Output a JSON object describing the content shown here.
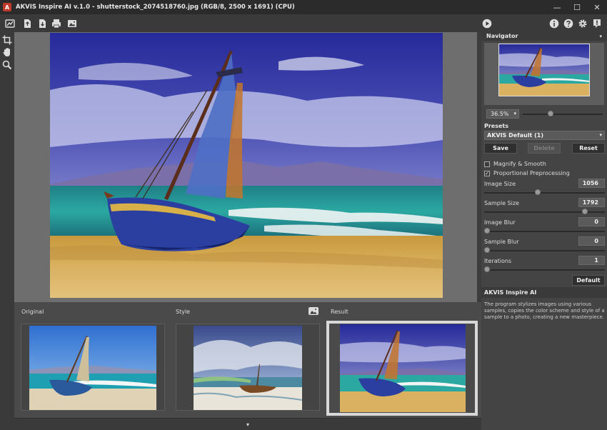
{
  "window": {
    "title": "AKVIS Inspire AI v.1.0 - shutterstock_2074518760.jpg (RGB/8, 2500 x 1691) (CPU)",
    "logo_letter": "A",
    "minimize_glyph": "—",
    "maximize_glyph": "☐",
    "close_glyph": "✕"
  },
  "toolbar": {
    "left_icons": [
      "home-icon",
      "open-file-icon",
      "save-file-icon",
      "print-icon",
      "image-icon"
    ],
    "right_icons": [
      "run-icon",
      "info-icon",
      "help-icon",
      "settings-icon",
      "notifications-icon"
    ]
  },
  "left_tools": [
    "crop-icon",
    "hand-icon",
    "zoom-icon"
  ],
  "thumbnails": {
    "original_label": "Original",
    "style_label": "Style",
    "result_label": "Result"
  },
  "collapse_glyph": "▾",
  "right_panel": {
    "navigator_title": "Navigator",
    "zoom_value": "36.5%",
    "zoom_arrow": "▾",
    "presets_title": "Presets",
    "preset_selected": "AKVIS Default (1)",
    "preset_arrow": "▾",
    "save_label": "Save",
    "delete_label": "Delete",
    "reset_label": "Reset",
    "magnify_label": "Magnify & Smooth",
    "magnify_checked": false,
    "proportional_label": "Proportional Preprocessing",
    "proportional_checked": true,
    "check_glyph": "✓",
    "params": {
      "image_size_label": "Image Size",
      "image_size_value": "1056",
      "sample_size_label": "Sample Size",
      "sample_size_value": "1792",
      "image_blur_label": "Image Blur",
      "image_blur_value": "0",
      "sample_blur_label": "Sample Blur",
      "sample_blur_value": "0",
      "iterations_label": "Iterations",
      "iterations_value": "1"
    },
    "default_label": "Default",
    "info_title": "AKVIS Inspire AI",
    "info_text": "The program stylizes images using various samples, copies the color scheme and style of a sample to a photo, creating a new masterpiece."
  },
  "colors": {
    "panel_bg": "#444444",
    "canvas_bg": "#6e6e6e",
    "accent_red": "#c0392b"
  }
}
